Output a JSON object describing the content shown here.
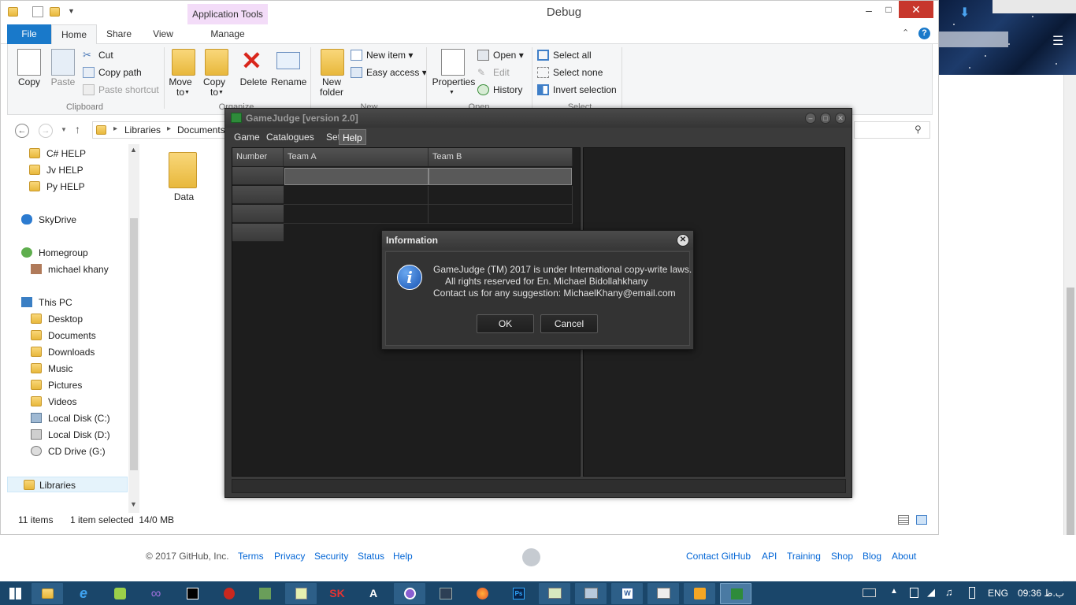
{
  "window": {
    "title": "Debug",
    "context_tab": "Application Tools",
    "tabs": [
      "File",
      "Home",
      "Share",
      "View",
      "Manage"
    ]
  },
  "ribbon": {
    "clipboard": {
      "label": "Clipboard",
      "copy": "Copy",
      "paste": "Paste",
      "cut": "Cut",
      "copy_path": "Copy path",
      "paste_shortcut": "Paste shortcut"
    },
    "organize": {
      "label": "Organize",
      "move_to": "Move to",
      "copy_to": "Copy to",
      "delete": "Delete",
      "rename": "Rename"
    },
    "new": {
      "label": "New",
      "new_folder": "New folder",
      "new_item": "New item",
      "easy_access": "Easy access"
    },
    "open": {
      "label": "Open",
      "properties": "Properties",
      "open": "Open",
      "edit": "Edit",
      "history": "History"
    },
    "select": {
      "label": "Select",
      "select_all": "Select all",
      "select_none": "Select none",
      "invert": "Invert selection"
    }
  },
  "address": {
    "crumbs": [
      "Libraries",
      "Documents"
    ]
  },
  "nav": {
    "items": [
      "C# HELP",
      "Jv HELP",
      "Py HELP",
      "SkyDrive",
      "Homegroup",
      "michael khany",
      "This PC",
      "Desktop",
      "Documents",
      "Downloads",
      "Music",
      "Pictures",
      "Videos",
      "Local Disk (C:)",
      "Local Disk (D:)",
      "CD Drive (G:)",
      "Libraries"
    ]
  },
  "content": {
    "folder_name": "Data"
  },
  "status": {
    "items": "11 items",
    "selected": "1 item selected  14/0 MB"
  },
  "gamejudge": {
    "title": "GameJudge [version 2.0]",
    "menu": [
      "Game",
      "Catalogues",
      "Set",
      "Help"
    ],
    "columns": [
      "Number",
      "Team A",
      "Team B"
    ]
  },
  "dialog": {
    "title": "Information",
    "line1": "GameJudge (TM) 2017 is under International copy-write laws.",
    "line2": "All rights reserved for En. Michael Bidollahkhany",
    "line3": "Contact us for any suggestion: MichaelKhany@email.com",
    "ok": "OK",
    "cancel": "Cancel"
  },
  "footer": {
    "copyright": "© 2017 GitHub, Inc.",
    "left_links": [
      "Terms",
      "Privacy",
      "Security",
      "Status",
      "Help"
    ],
    "right_links": [
      "Contact GitHub",
      "API",
      "Training",
      "Shop",
      "Blog",
      "About"
    ]
  },
  "tray": {
    "lang": "ENG",
    "time": "09:36 ب.ظ"
  },
  "colors": {
    "file_tab": "#1979ca",
    "context_tab": "#f3dcf8",
    "link": "#0366d6",
    "taskbar": "#1a466a"
  }
}
